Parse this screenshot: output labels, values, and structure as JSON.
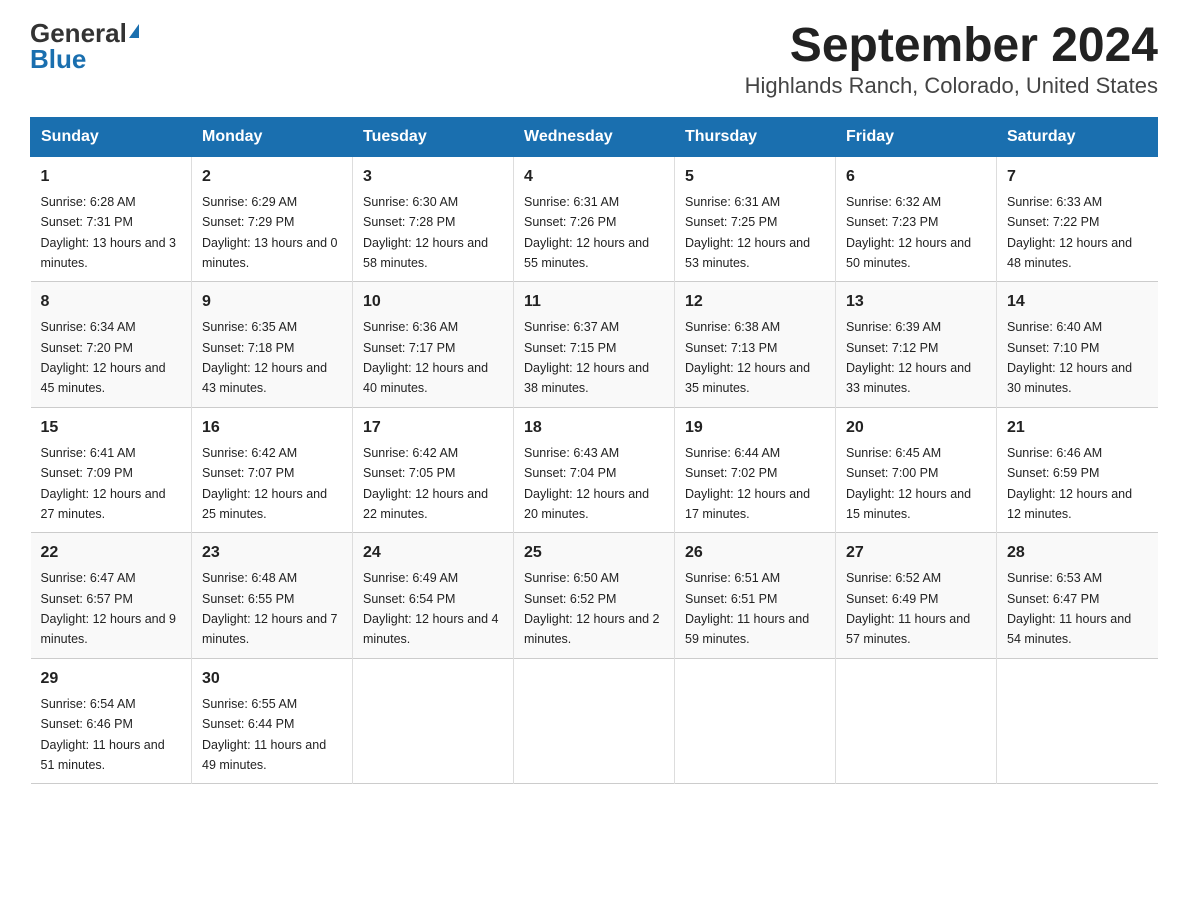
{
  "logo": {
    "general": "General",
    "triangle": "▶",
    "blue": "Blue"
  },
  "title": "September 2024",
  "subtitle": "Highlands Ranch, Colorado, United States",
  "days_header": [
    "Sunday",
    "Monday",
    "Tuesday",
    "Wednesday",
    "Thursday",
    "Friday",
    "Saturday"
  ],
  "weeks": [
    [
      {
        "num": "1",
        "sunrise": "6:28 AM",
        "sunset": "7:31 PM",
        "daylight": "13 hours and 3 minutes."
      },
      {
        "num": "2",
        "sunrise": "6:29 AM",
        "sunset": "7:29 PM",
        "daylight": "13 hours and 0 minutes."
      },
      {
        "num": "3",
        "sunrise": "6:30 AM",
        "sunset": "7:28 PM",
        "daylight": "12 hours and 58 minutes."
      },
      {
        "num": "4",
        "sunrise": "6:31 AM",
        "sunset": "7:26 PM",
        "daylight": "12 hours and 55 minutes."
      },
      {
        "num": "5",
        "sunrise": "6:31 AM",
        "sunset": "7:25 PM",
        "daylight": "12 hours and 53 minutes."
      },
      {
        "num": "6",
        "sunrise": "6:32 AM",
        "sunset": "7:23 PM",
        "daylight": "12 hours and 50 minutes."
      },
      {
        "num": "7",
        "sunrise": "6:33 AM",
        "sunset": "7:22 PM",
        "daylight": "12 hours and 48 minutes."
      }
    ],
    [
      {
        "num": "8",
        "sunrise": "6:34 AM",
        "sunset": "7:20 PM",
        "daylight": "12 hours and 45 minutes."
      },
      {
        "num": "9",
        "sunrise": "6:35 AM",
        "sunset": "7:18 PM",
        "daylight": "12 hours and 43 minutes."
      },
      {
        "num": "10",
        "sunrise": "6:36 AM",
        "sunset": "7:17 PM",
        "daylight": "12 hours and 40 minutes."
      },
      {
        "num": "11",
        "sunrise": "6:37 AM",
        "sunset": "7:15 PM",
        "daylight": "12 hours and 38 minutes."
      },
      {
        "num": "12",
        "sunrise": "6:38 AM",
        "sunset": "7:13 PM",
        "daylight": "12 hours and 35 minutes."
      },
      {
        "num": "13",
        "sunrise": "6:39 AM",
        "sunset": "7:12 PM",
        "daylight": "12 hours and 33 minutes."
      },
      {
        "num": "14",
        "sunrise": "6:40 AM",
        "sunset": "7:10 PM",
        "daylight": "12 hours and 30 minutes."
      }
    ],
    [
      {
        "num": "15",
        "sunrise": "6:41 AM",
        "sunset": "7:09 PM",
        "daylight": "12 hours and 27 minutes."
      },
      {
        "num": "16",
        "sunrise": "6:42 AM",
        "sunset": "7:07 PM",
        "daylight": "12 hours and 25 minutes."
      },
      {
        "num": "17",
        "sunrise": "6:42 AM",
        "sunset": "7:05 PM",
        "daylight": "12 hours and 22 minutes."
      },
      {
        "num": "18",
        "sunrise": "6:43 AM",
        "sunset": "7:04 PM",
        "daylight": "12 hours and 20 minutes."
      },
      {
        "num": "19",
        "sunrise": "6:44 AM",
        "sunset": "7:02 PM",
        "daylight": "12 hours and 17 minutes."
      },
      {
        "num": "20",
        "sunrise": "6:45 AM",
        "sunset": "7:00 PM",
        "daylight": "12 hours and 15 minutes."
      },
      {
        "num": "21",
        "sunrise": "6:46 AM",
        "sunset": "6:59 PM",
        "daylight": "12 hours and 12 minutes."
      }
    ],
    [
      {
        "num": "22",
        "sunrise": "6:47 AM",
        "sunset": "6:57 PM",
        "daylight": "12 hours and 9 minutes."
      },
      {
        "num": "23",
        "sunrise": "6:48 AM",
        "sunset": "6:55 PM",
        "daylight": "12 hours and 7 minutes."
      },
      {
        "num": "24",
        "sunrise": "6:49 AM",
        "sunset": "6:54 PM",
        "daylight": "12 hours and 4 minutes."
      },
      {
        "num": "25",
        "sunrise": "6:50 AM",
        "sunset": "6:52 PM",
        "daylight": "12 hours and 2 minutes."
      },
      {
        "num": "26",
        "sunrise": "6:51 AM",
        "sunset": "6:51 PM",
        "daylight": "11 hours and 59 minutes."
      },
      {
        "num": "27",
        "sunrise": "6:52 AM",
        "sunset": "6:49 PM",
        "daylight": "11 hours and 57 minutes."
      },
      {
        "num": "28",
        "sunrise": "6:53 AM",
        "sunset": "6:47 PM",
        "daylight": "11 hours and 54 minutes."
      }
    ],
    [
      {
        "num": "29",
        "sunrise": "6:54 AM",
        "sunset": "6:46 PM",
        "daylight": "11 hours and 51 minutes."
      },
      {
        "num": "30",
        "sunrise": "6:55 AM",
        "sunset": "6:44 PM",
        "daylight": "11 hours and 49 minutes."
      },
      null,
      null,
      null,
      null,
      null
    ]
  ],
  "labels": {
    "sunrise": "Sunrise:",
    "sunset": "Sunset:",
    "daylight": "Daylight:"
  }
}
